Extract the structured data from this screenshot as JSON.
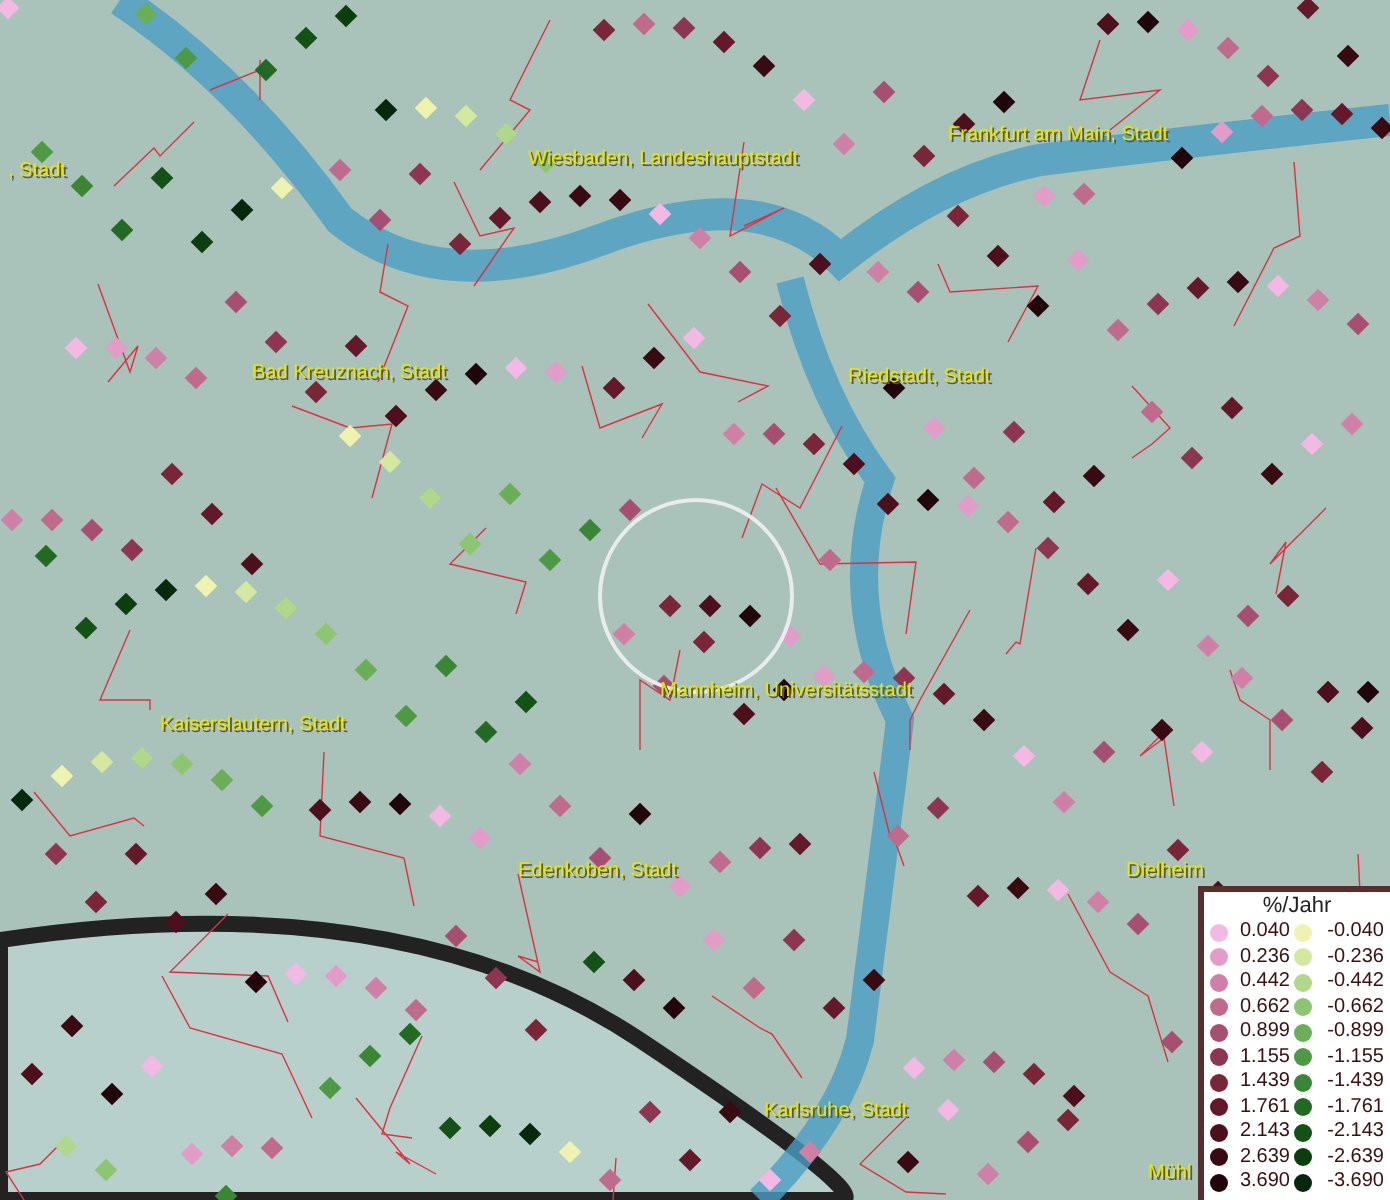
{
  "map": {
    "places": [
      {
        "kind": "town",
        "label": ", Stadt"
      },
      {
        "kind": "town",
        "label": "Wiesbaden, Landeshauptstadt"
      },
      {
        "kind": "town",
        "label": "Frankfurt am Main, Stadt"
      },
      {
        "kind": "town",
        "label": "Bad Kreuznach, Stadt"
      },
      {
        "kind": "town",
        "label": "Riedstadt, Stadt"
      },
      {
        "kind": "town",
        "label": "Mannheim, Universitätsstadt"
      },
      {
        "kind": "town",
        "label": "Kaiserslautern, Stadt"
      },
      {
        "kind": "town",
        "label": "Edenkoben, Stadt"
      },
      {
        "kind": "town",
        "label": "Dielheim"
      },
      {
        "kind": "town",
        "label": "Karlsruhe, Stadt"
      },
      {
        "kind": "town",
        "label": "Mühl"
      }
    ]
  },
  "legend": {
    "title": "%/Jahr",
    "rows": [
      {
        "rise": {
          "label": "0.040",
          "color": "#f4b8e4"
        },
        "fall": {
          "label": "-0.040",
          "color": "#eef3b0"
        }
      },
      {
        "rise": {
          "label": "0.236",
          "color": "#e39cc8"
        },
        "fall": {
          "label": "-0.236",
          "color": "#d4e8a0"
        }
      },
      {
        "rise": {
          "label": "0.442",
          "color": "#d07fa6"
        },
        "fall": {
          "label": "-0.442",
          "color": "#b0d88a"
        }
      },
      {
        "rise": {
          "label": "0.662",
          "color": "#c06a8e"
        },
        "fall": {
          "label": "-0.662",
          "color": "#8cc670"
        }
      },
      {
        "rise": {
          "label": "0.899",
          "color": "#a84e72"
        },
        "fall": {
          "label": "-0.899",
          "color": "#6aae58"
        }
      },
      {
        "rise": {
          "label": "1.155",
          "color": "#8e3552"
        },
        "fall": {
          "label": "-1.155",
          "color": "#4e9a44"
        }
      },
      {
        "rise": {
          "label": "1.439",
          "color": "#7a2538"
        },
        "fall": {
          "label": "-1.439",
          "color": "#3a8634"
        }
      },
      {
        "rise": {
          "label": "1.761",
          "color": "#64182a"
        },
        "fall": {
          "label": "-1.761",
          "color": "#226a22"
        }
      },
      {
        "rise": {
          "label": "2.143",
          "color": "#4e0f1c"
        },
        "fall": {
          "label": "-2.143",
          "color": "#125214"
        }
      },
      {
        "rise": {
          "label": "2.639",
          "color": "#3a0a12"
        },
        "fall": {
          "label": "-2.639",
          "color": "#0a3e0c"
        }
      },
      {
        "rise": {
          "label": "3.690",
          "color": "#22050a"
        },
        "fall": {
          "label": "-3.690",
          "color": "#06280a"
        }
      }
    ]
  }
}
